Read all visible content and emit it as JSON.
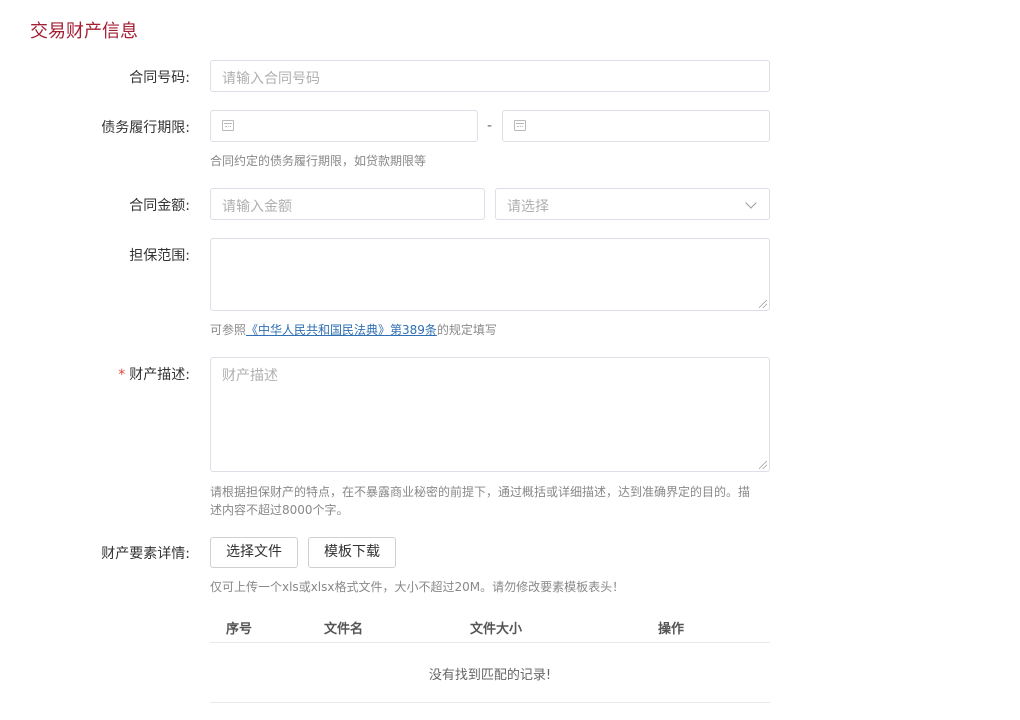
{
  "section": {
    "title": "交易财产信息"
  },
  "fields": {
    "contract_no": {
      "label": "合同号码:",
      "placeholder": "请输入合同号码"
    },
    "debt_period": {
      "label": "债务履行期限:",
      "start": "",
      "end": "",
      "separator": "-",
      "help": "合同约定的债务履行期限，如贷款期限等"
    },
    "amount": {
      "label": "合同金额:",
      "placeholder": "请输入金额",
      "currency_placeholder": "请选择"
    },
    "guarantee_scope": {
      "label": "担保范围:",
      "value": "",
      "help_prefix": "可参照",
      "help_link": "《中华人民共和国民法典》第389条",
      "help_suffix": "的规定填写"
    },
    "property_desc": {
      "required_mark": "*",
      "label": "财产描述:",
      "placeholder": "财产描述",
      "help_line1": "请根据担保财产的特点，在不暴露商业秘密的前提下，通过概括或详细描述，达到准确界定的目的。描",
      "help_line2": "述内容不超过8000个字。"
    },
    "property_details": {
      "label": "财产要素详情:",
      "choose_file": "选择文件",
      "download_template": "模板下载",
      "help": "仅可上传一个xls或xlsx格式文件，大小不超过20M。请勿修改要素模板表头！"
    }
  },
  "file_table": {
    "columns": [
      "序号",
      "文件名",
      "文件大小",
      "操作"
    ],
    "empty_text": "没有找到匹配的记录!"
  }
}
